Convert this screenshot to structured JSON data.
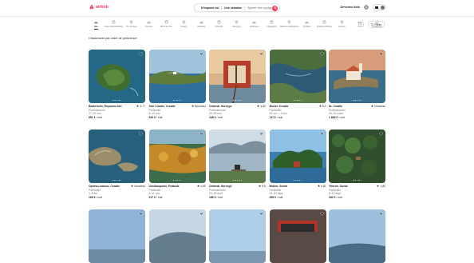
{
  "brand": {
    "name": "airbnb",
    "color": "#ff385c"
  },
  "search": {
    "where": "N'importe où",
    "when": "Une semaine",
    "who": "Ajouter des voyageurs"
  },
  "nav": {
    "host_link": "Devenez hôte"
  },
  "categories": [
    {
      "label": "Iles",
      "icon": "island-icon",
      "active": true
    },
    {
      "label": "Vues extraordinaires",
      "icon": "view-icon"
    },
    {
      "label": "Tiny houses",
      "icon": "tiny-house-icon"
    },
    {
      "label": "Fermes",
      "icon": "farm-icon"
    },
    {
      "label": "Bord de mer",
      "icon": "beach-icon"
    },
    {
      "label": "Design",
      "icon": "design-icon"
    },
    {
      "label": "Cabanes",
      "icon": "cabin-icon"
    },
    {
      "label": "Piscines",
      "icon": "pool-icon"
    },
    {
      "label": "Camping",
      "icon": "camping-icon"
    },
    {
      "label": "Châteaux",
      "icon": "castle-icon"
    },
    {
      "label": "Campagne",
      "icon": "countryside-icon"
    },
    {
      "label": "Maisons troglodytes",
      "icon": "cave-icon"
    },
    {
      "label": "Arctique",
      "icon": "arctic-icon"
    },
    {
      "label": "Maisons d'hôtes",
      "icon": "bnb-icon"
    },
    {
      "label": "Domes",
      "icon": "dome-icon"
    },
    {
      "label": "Lac",
      "icon": "lake-icon"
    },
    {
      "label": "Tendances",
      "icon": "trending-icon"
    }
  ],
  "filters_label": "Filtres",
  "sort_text": "Classement par ordre de pertinence",
  "listings": [
    {
      "title": "Baderholm, Royaume-Uni",
      "rating": "4,77",
      "sub": "Professionnel",
      "dates": "17–22 nov.",
      "price": "851 €",
      "per": "/ nuit",
      "scene": "island"
    },
    {
      "title": "Sali, Croatie, Croatie",
      "rating": "Nouveau",
      "sub": "Particulier",
      "dates": "8–13 nov.",
      "price": "534 €",
      "per": "/ nuit",
      "scene": "coast"
    },
    {
      "title": "Odderøl, Norvège",
      "rating": "4,82",
      "sub": "Professionnel",
      "dates": "20–25 nov.",
      "price": "248 €",
      "per": "/ nuit",
      "scene": "sauna"
    },
    {
      "title": "Murter, Croatie",
      "rating": "5,0",
      "sub": "Particulier",
      "dates": "20 oct. – 3 nov.",
      "price": "117 €",
      "per": "/ nuit",
      "scene": "bay"
    },
    {
      "title": "Iiz, Croatie",
      "rating": "Nouveau",
      "sub": "Professionnel",
      "dates": "26–31 mars",
      "price": "1 800 €",
      "per": "/ nuit",
      "scene": "church"
    },
    {
      "title": "Općina Lastovo, Croatie",
      "rating": "Nouveau",
      "sub": "Particulier",
      "dates": "1–6 avr.",
      "price": "108 €",
      "per": "/ nuit",
      "scene": "rocks"
    },
    {
      "title": "Uusikaupunki, Finlande",
      "rating": "4,92",
      "sub": "Particulier",
      "dates": "6–11 nov.",
      "price": "217 €",
      "per": "/ nuit",
      "scene": "autumn"
    },
    {
      "title": "Odderøl, Norvège",
      "rating": "5,0",
      "sub": "Professionnel",
      "dates": "22–29 avril",
      "price": "186 €",
      "per": "/ nuit",
      "scene": "lakeside"
    },
    {
      "title": "Mollen, Suède",
      "rating": "4,81",
      "sub": "Particulier",
      "dates": "19–24 sept.",
      "price": "255 €",
      "per": "/ nuit",
      "scene": "trees"
    },
    {
      "title": "Ytterön, Suède",
      "rating": "4,80",
      "sub": "Particulier",
      "dates": "5–10 sept.",
      "price": "282 €",
      "per": "/ nuit",
      "scene": "forest"
    }
  ],
  "row3_scenes": [
    "sky",
    "fjord",
    "sky2",
    "redboat",
    "dusk"
  ]
}
